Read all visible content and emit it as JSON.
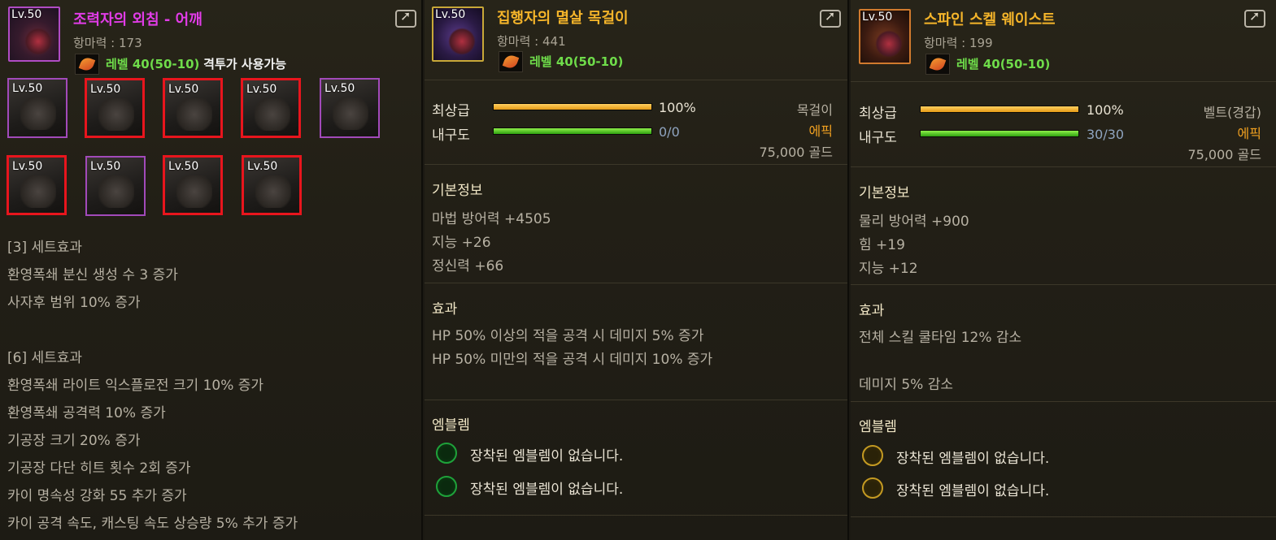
{
  "panel1": {
    "item": {
      "level": "Lv.50",
      "name": "조력자의 외침 - 어깨",
      "name_color": "#e23ce8",
      "resist": "항마력 : 173",
      "req_level": "레벨 40(50-10)",
      "req_class": "격투가 사용가능"
    },
    "set_items": [
      {
        "level": "Lv.50",
        "border": "purple"
      },
      {
        "level": "Lv.50",
        "border": "red"
      },
      {
        "level": "Lv.50",
        "border": "red"
      },
      {
        "level": "Lv.50",
        "border": "red"
      },
      {
        "level": "Lv.50",
        "border": "purple"
      },
      {
        "level": "Lv.50",
        "border": "red"
      },
      {
        "level": "Lv.50",
        "border": "purple"
      },
      {
        "level": "Lv.50",
        "border": "red"
      },
      {
        "level": "Lv.50",
        "border": "red"
      }
    ],
    "set3_title": "[3] 세트효과",
    "set3": [
      "환영폭쇄 분신 생성 수 3 증가",
      "사자후 범위 10% 증가"
    ],
    "set6_title": "[6] 세트효과",
    "set6": [
      "환영폭쇄 라이트 익스플로전 크기 10% 증가",
      "환영폭쇄 공격력 10% 증가",
      "기공장 크기 20% 증가",
      "기공장 다단 히트 횟수 2회 증가",
      "카이 명속성 강화 55 추가 증가",
      "카이 공격 속도, 캐스팅 속도 상승량 5% 추가 증가"
    ]
  },
  "panel2": {
    "item": {
      "level": "Lv.50",
      "name": "집행자의 멸살 목걸이",
      "name_color": "#f5b52a",
      "resist": "항마력 : 441",
      "req_level": "레벨 40(50-10)"
    },
    "grade_label": "최상급",
    "grade_value": 1.0,
    "grade_text": "100%",
    "durability_label": "내구도",
    "durability_value": 0.0,
    "durability_text": "0/0",
    "type": "목걸이",
    "rarity": "에픽",
    "price": "75,000 골드",
    "basic_title": "기본정보",
    "basic": [
      "마법 방어력 +4505",
      "지능 +26",
      "정신력 +66"
    ],
    "effect_title": "효과",
    "effects": [
      "HP 50% 이상의 적을 공격 시 데미지 5% 증가",
      "HP 50% 미만의 적을 공격 시 데미지 10% 증가"
    ],
    "emblem_title": "엠블렘",
    "emblems": [
      "장착된 엠블렘이 없습니다.",
      "장착된 엠블렘이 없습니다."
    ]
  },
  "panel3": {
    "item": {
      "level": "Lv.50",
      "name": "스파인 스켈 웨이스트",
      "name_color": "#f5b52a",
      "resist": "항마력 : 199",
      "req_level": "레벨 40(50-10)"
    },
    "grade_label": "최상급",
    "grade_value": 1.0,
    "grade_text": "100%",
    "durability_label": "내구도",
    "durability_value": 1.0,
    "durability_text": "30/30",
    "type": "벨트(경갑)",
    "rarity": "에픽",
    "price": "75,000 골드",
    "basic_title": "기본정보",
    "basic": [
      "물리 방어력 +900",
      "힘 +19",
      "지능 +12"
    ],
    "effect_title": "효과",
    "effects": [
      "전체 스킬 쿨타임 12% 감소",
      "데미지 5% 감소"
    ],
    "emblem_title": "엠블렘",
    "emblems": [
      "장착된 엠블렘이 없습니다.",
      "장착된 엠블렘이 없습니다."
    ]
  },
  "colors": {
    "epic": "#f0a020",
    "set_item_name": "#e23ce8",
    "req_green": "#6fdc4a",
    "red_highlight": "#e8151d"
  }
}
